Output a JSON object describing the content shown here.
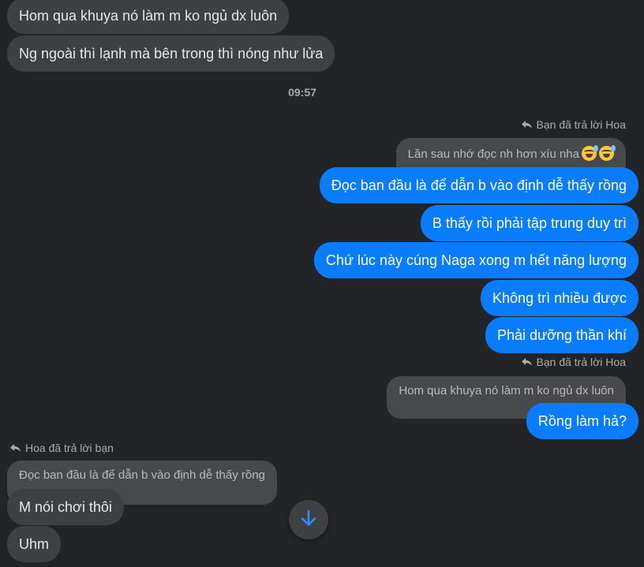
{
  "messages_top": [
    {
      "text": "Hom qua khuya nó làm m ko ngủ dx luôn"
    },
    {
      "text": "Ng ngoài thì lạnh mà bên trong thì nóng như lửa"
    }
  ],
  "timestamp": "09:57",
  "reply_group_1": {
    "label": "Bạn đã trả lời Hoa",
    "quoted": "Lần sau nhớ đọc nh hơn xíu nha",
    "quoted_emoji": "sweat-smile-emoji"
  },
  "outgoing_1": [
    {
      "text": "Đọc ban đầu là để dẫn b vào định dễ thấy rồng"
    },
    {
      "text": "B thấy rồi phải tập trung duy trì"
    },
    {
      "text": "Chứ lúc này cúng Naga xong m hết năng lượng"
    },
    {
      "text": "Không trì nhiều được"
    },
    {
      "text": "Phải dưỡng thần khí"
    }
  ],
  "reply_group_2": {
    "label": "Bạn đã trả lời Hoa",
    "quoted": "Hom qua khuya nó làm m ko ngủ dx luôn",
    "reply": "Rồng làm hả?"
  },
  "reply_group_3": {
    "label": "Hoa đã trả lời bạn",
    "quoted": "Đọc ban đầu là để dẫn b vào định dễ thấy rồng"
  },
  "incoming_bottom": [
    {
      "text": "M nói chơi thôi"
    },
    {
      "text": "Uhm"
    }
  ],
  "icons": {
    "reply": "reply-arrow-icon",
    "scroll_down": "arrow-down-icon"
  },
  "colors": {
    "background": "#232427",
    "incoming_bubble": "#3e4042",
    "outgoing_bubble": "#0a7cff",
    "quoted_bubble": "#47494b",
    "accent": "#0a7cff"
  }
}
